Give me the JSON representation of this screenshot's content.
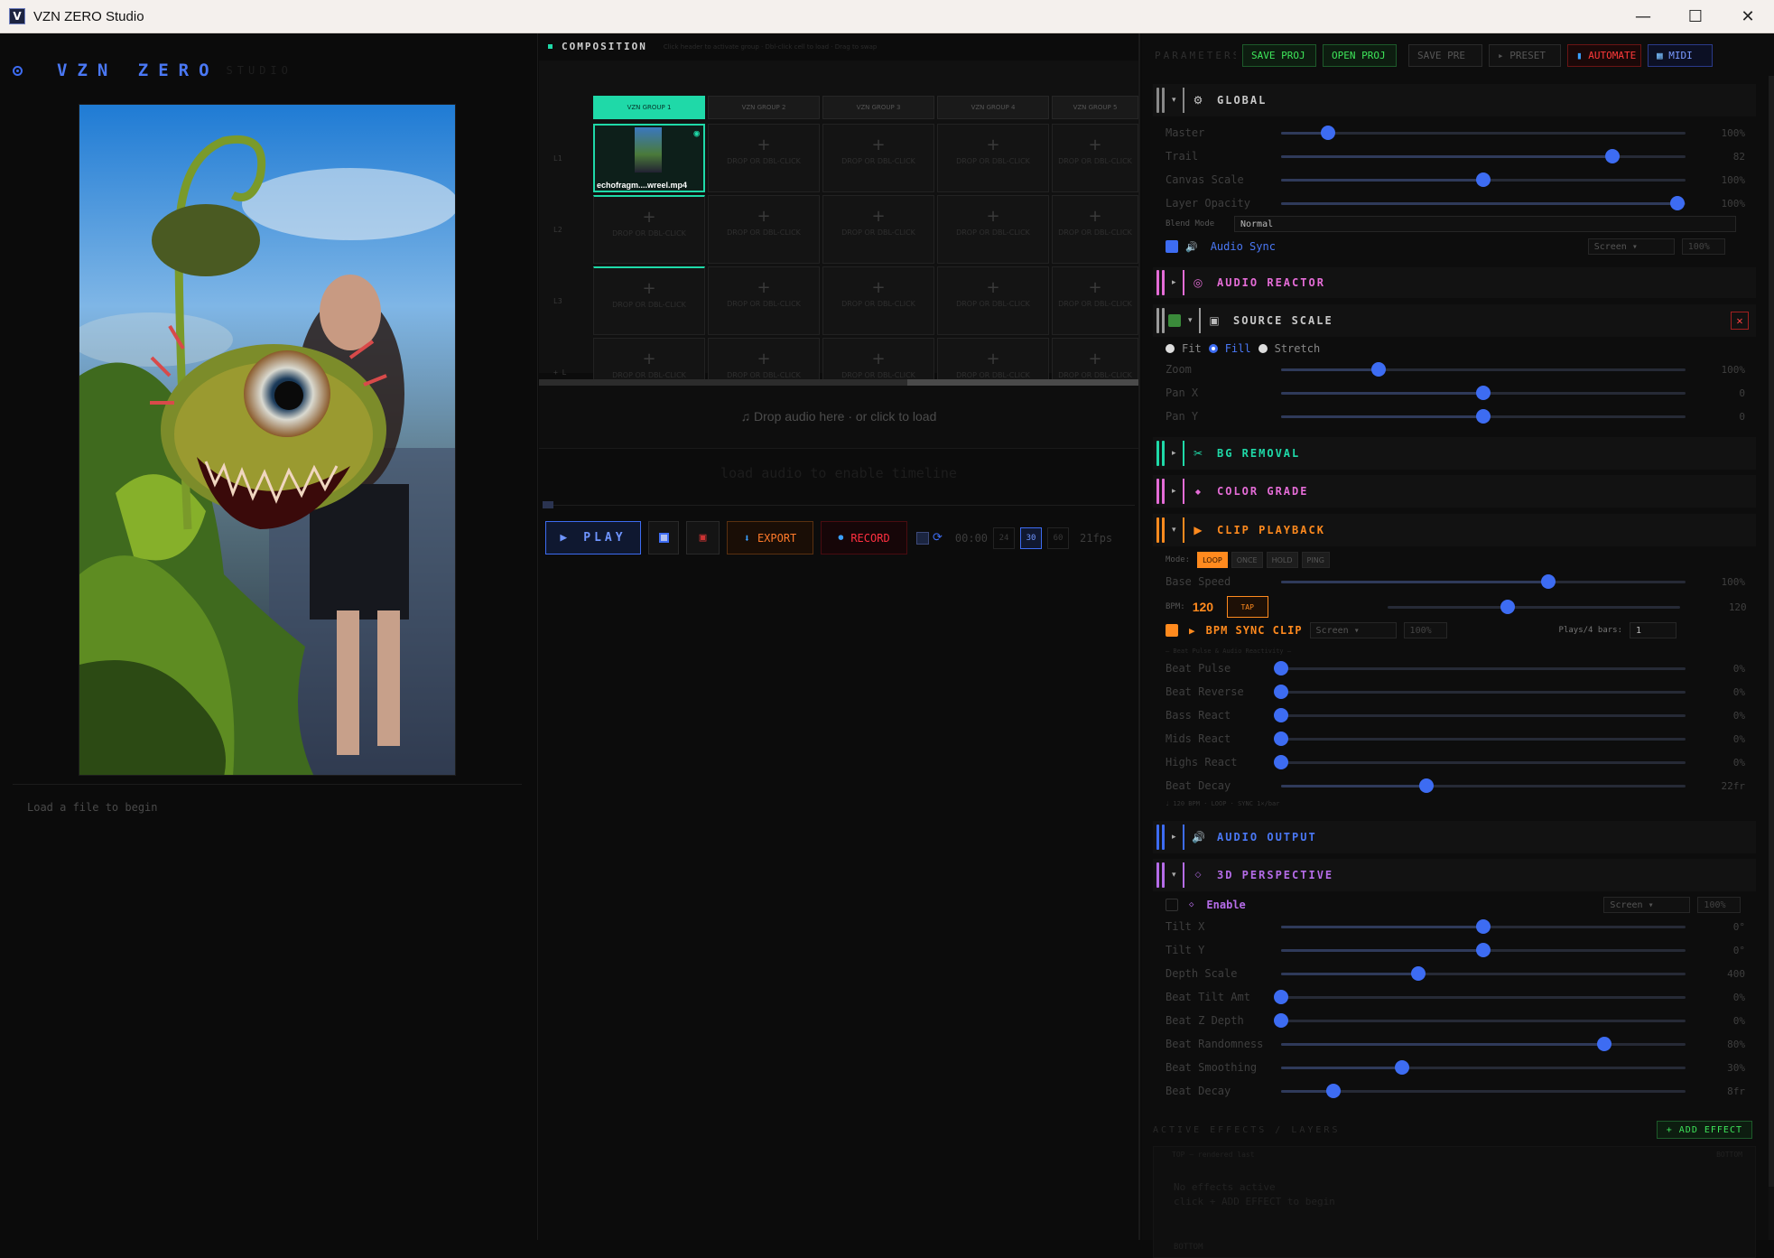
{
  "window": {
    "title": "VZN ZERO Studio",
    "minimize": "—",
    "maximize": "☐",
    "close": "✕"
  },
  "brand": {
    "name": "VZN ZERO",
    "sub": "STUDIO"
  },
  "left": {
    "status": "Load a file to begin"
  },
  "composition": {
    "title": "COMPOSITION",
    "hint": "Click header to activate group · Dbl-click cell to load · Drag to swap",
    "groups": [
      "VZN GROUP 1",
      "VZN GROUP 2",
      "VZN GROUP 3",
      "VZN GROUP 4",
      "VZN GROUP 5"
    ],
    "rows": [
      "L1",
      "L2",
      "L3",
      "+ L"
    ],
    "cell_hint": "DROP OR DBL-CLICK",
    "clip_name": "echofragm....wreel.mp4",
    "audio_drop": "Drop audio here · or click to load",
    "timeline_msg": "load audio to enable timeline"
  },
  "transport": {
    "play": "PLAY",
    "export": "EXPORT",
    "record": "RECORD",
    "time": "00:00",
    "fps_options": [
      "24",
      "30",
      "60"
    ],
    "fps_selected": "30",
    "fps_readout": "21fps"
  },
  "toolbar": {
    "params_label": "PARAMETERS",
    "save_proj": "SAVE PROJ",
    "open_proj": "OPEN PROJ",
    "save_preset": "SAVE PRE",
    "preset": "PRESET",
    "automate": "AUTOMATE",
    "midi": "MIDI"
  },
  "global": {
    "title": "GLOBAL",
    "params": [
      {
        "label": "Master",
        "value": "100%",
        "level": 0.115
      },
      {
        "label": "Trail",
        "value": "82",
        "level": 0.82
      },
      {
        "label": "Canvas Scale",
        "value": "100%",
        "level": 0.5
      },
      {
        "label": "Layer Opacity",
        "value": "100%",
        "level": 0.98
      }
    ],
    "blend_label": "Blend Mode",
    "blend_value": "Normal",
    "audio_sync": "Audio Sync",
    "audio_sync_mode": "Screen",
    "audio_sync_amt": "100%"
  },
  "sections": {
    "audio_reactor": "AUDIO REACTOR",
    "source_scale": "SOURCE SCALE",
    "bg_removal": "BG REMOVAL",
    "color_grade": "COLOR GRADE",
    "clip_playback": "CLIP PLAYBACK",
    "audio_output": "AUDIO OUTPUT",
    "perspective": "3D PERSPECTIVE"
  },
  "source_scale": {
    "fit": "Fit",
    "fill": "Fill",
    "stretch": "Stretch",
    "params": [
      {
        "label": "Zoom",
        "value": "100%",
        "level": 0.24
      },
      {
        "label": "Pan X",
        "value": "0",
        "level": 0.5
      },
      {
        "label": "Pan Y",
        "value": "0",
        "level": 0.5
      }
    ]
  },
  "clip_playback": {
    "mode_label": "Mode:",
    "modes": [
      "LOOP",
      "ONCE",
      "HOLD",
      "PING"
    ],
    "mode_selected": "LOOP",
    "base_speed": {
      "label": "Base Speed",
      "value": "100%",
      "level": 0.66
    },
    "bpm_label": "BPM:",
    "bpm_value": "120",
    "tap": "TAP",
    "bpm_slider_value": "120",
    "bpm_level": 0.41,
    "bpm_sync": "BPM SYNC CLIP",
    "bpm_sync_mode": "Screen",
    "bpm_sync_amt": "100%",
    "plays_label": "Plays/4 bars:",
    "plays_value": "1",
    "subhint": "— Beat Pulse & Audio Reactivity —",
    "params": [
      {
        "label": "Beat Pulse",
        "value": "0%",
        "level": 0.0
      },
      {
        "label": "Beat Reverse",
        "value": "0%",
        "level": 0.0
      },
      {
        "label": "Bass React",
        "value": "0%",
        "level": 0.0
      },
      {
        "label": "Mids React",
        "value": "0%",
        "level": 0.0
      },
      {
        "label": "Highs React",
        "value": "0%",
        "level": 0.0
      },
      {
        "label": "Beat Decay",
        "value": "22fr",
        "level": 0.36
      }
    ],
    "footer": "♩ 120 BPM · LOOP · SYNC 1×/bar"
  },
  "perspective": {
    "enable": "Enable",
    "mode": "Screen",
    "amt": "100%",
    "params": [
      {
        "label": "Tilt X",
        "value": "0°",
        "level": 0.5
      },
      {
        "label": "Tilt Y",
        "value": "0°",
        "level": 0.5
      },
      {
        "label": "Depth Scale",
        "value": "400",
        "level": 0.34
      },
      {
        "label": "Beat Tilt Amt",
        "value": "0%",
        "level": 0.0
      },
      {
        "label": "Beat Z Depth",
        "value": "0%",
        "level": 0.0
      },
      {
        "label": "Beat Randomness",
        "value": "80%",
        "level": 0.8
      },
      {
        "label": "Beat Smoothing",
        "value": "30%",
        "level": 0.3
      },
      {
        "label": "Beat Decay",
        "value": "8fr",
        "level": 0.13
      }
    ]
  },
  "effects": {
    "title": "ACTIVE EFFECTS / LAYERS",
    "add": "+ ADD EFFECT",
    "top": "TOP — rendered last",
    "bottom": "BOTTOM",
    "empty1": "No effects active",
    "empty2": "click  + ADD EFFECT  to begin",
    "bottom2": "BOTTOM"
  },
  "colors": {
    "accent_blue": "#3d6cf2",
    "teal": "#1fd9a8",
    "orange": "#ff8a1e",
    "pink": "#e46cd6",
    "purple": "#b56ce8",
    "green": "#3ee55a",
    "red": "#ff3a3a"
  }
}
